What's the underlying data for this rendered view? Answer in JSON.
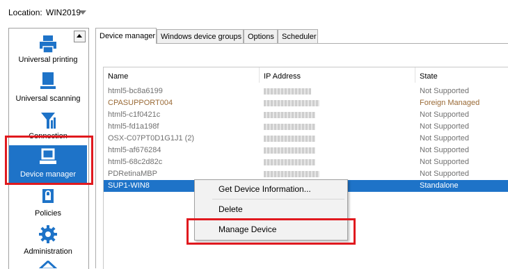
{
  "location": {
    "label": "Location:",
    "value": "WIN2019"
  },
  "sidebar": {
    "items": [
      {
        "label": "Universal printing",
        "icon": "printer-icon"
      },
      {
        "label": "Universal scanning",
        "icon": "scanner-icon"
      },
      {
        "label": "Connection",
        "icon": "antenna-icon"
      },
      {
        "label": "Device manager",
        "icon": "laptop-icon"
      },
      {
        "label": "Policies",
        "icon": "policy-lock-icon"
      },
      {
        "label": "Administration",
        "icon": "gear-icon"
      }
    ],
    "selected": "Device manager",
    "selected_color": "#1e73c8"
  },
  "tabs": [
    "Device manager",
    "Windows device groups",
    "Options",
    "Scheduler"
  ],
  "table": {
    "headers": [
      "Name",
      "IP Address",
      "State"
    ],
    "rows": [
      {
        "name": "html5-bc8a6199",
        "state": "Not Supported"
      },
      {
        "name": "CPASUPPORT004",
        "state": "Foreign Managed"
      },
      {
        "name": "html5-c1f0421c",
        "state": "Not Supported"
      },
      {
        "name": "html5-fd1a198f",
        "state": "Not Supported"
      },
      {
        "name": "OSX-C07PT0D1G1J1 (2)",
        "state": "Not Supported"
      },
      {
        "name": "html5-af676284",
        "state": "Not Supported"
      },
      {
        "name": "html5-68c2d82c",
        "state": "Not Supported"
      },
      {
        "name": "PDRetinaMBP",
        "state": "Not Supported"
      },
      {
        "name": "SUP1-WIN8",
        "state": "Standalone"
      }
    ],
    "selected_row": "SUP1-WIN8"
  },
  "context_menu": {
    "items": [
      "Get Device Information...",
      "Delete",
      "Manage Device"
    ]
  },
  "colors": {
    "highlight_border": "#e0191e",
    "selection": "#1e73c8",
    "foreign_managed": "#9a6a36"
  }
}
